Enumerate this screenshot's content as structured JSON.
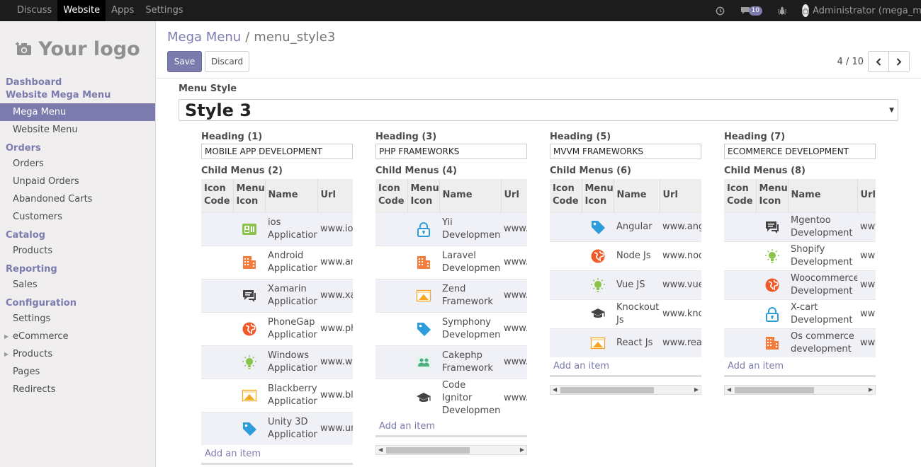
{
  "topbar": {
    "menu": [
      "Discuss",
      "Website",
      "Apps",
      "Settings"
    ],
    "active": "Website",
    "badge_count": "10",
    "user": "Administrator (mega_m..."
  },
  "logo": {
    "text": "Your logo"
  },
  "sidebar": {
    "groups": [
      {
        "title": "Dashboard",
        "items": []
      },
      {
        "title": "Website Mega Menu",
        "items": [
          "Mega Menu",
          "Website Menu"
        ]
      },
      {
        "title": "Orders",
        "items": [
          "Orders",
          "Unpaid Orders",
          "Abandoned Carts",
          "Customers"
        ]
      },
      {
        "title": "Catalog",
        "items": [
          "Products"
        ]
      },
      {
        "title": "Reporting",
        "items": [
          "Sales"
        ]
      },
      {
        "title": "Configuration",
        "items": [
          "Settings",
          "eCommerce",
          "Products",
          "Pages",
          "Redirects"
        ]
      }
    ],
    "active_item": "Mega Menu"
  },
  "breadcrumb": {
    "parent": "Mega Menu",
    "separator": "/",
    "current": "menu_style3"
  },
  "buttons": {
    "save": "Save",
    "discard": "Discard"
  },
  "pager": {
    "value": "4 / 10"
  },
  "menu_style": {
    "label": "Menu Style",
    "value": "Style 3"
  },
  "table_headers": {
    "icon_code": "Icon Code",
    "menu_icon": "Menu Icon",
    "name": "Name",
    "url": "Url"
  },
  "add_item_label": "Add an item",
  "columns": [
    {
      "heading_label": "Heading (1)",
      "heading_value": "MOBILE APP DEVELOPMENT",
      "child_label": "Child Menus (2)",
      "rows": [
        {
          "icon": "contact-card-icon",
          "color": "#8bc34a",
          "name": "ios Application",
          "url": "www.ios"
        },
        {
          "icon": "building-icon",
          "color": "#f47c3c",
          "name": "Android Application",
          "url": "www.an"
        },
        {
          "icon": "chat-icon",
          "color": "#444444",
          "name": "Xamarin Application",
          "url": "www.xar"
        },
        {
          "icon": "globe-icon",
          "color": "#f05a28",
          "name": "PhoneGap Application",
          "url": "www.ph"
        },
        {
          "icon": "bulb-icon",
          "color": "#8bc34a",
          "name": "Windows Application",
          "url": "www.wir"
        },
        {
          "icon": "image-icon",
          "color": "#f5a623",
          "name": "Blackberry Application",
          "url": "www.bla"
        },
        {
          "icon": "tag-icon",
          "color": "#2d9cdb",
          "name": "Unity 3D Application",
          "url": "www.un"
        }
      ]
    },
    {
      "heading_label": "Heading (3)",
      "heading_value": "PHP FRAMEWORKS",
      "child_label": "Child Menus (4)",
      "rows": [
        {
          "icon": "lock-icon",
          "color": "#2d9cdb",
          "name": "Yii Development",
          "url": "www.y"
        },
        {
          "icon": "building-icon",
          "color": "#f47c3c",
          "name": "Laravel Development",
          "url": "www.l"
        },
        {
          "icon": "image-icon",
          "color": "#f5a623",
          "name": "Zend Framework",
          "url": "www.z"
        },
        {
          "icon": "tag-icon",
          "color": "#2d9cdb",
          "name": "Symphony Development",
          "url": "www.s"
        },
        {
          "icon": "group-icon",
          "color": "#4caf82",
          "name": "Cakephp Framework",
          "url": "www.c"
        },
        {
          "icon": "graduation-cap-icon",
          "color": "#444444",
          "name": "Code Ignitor Development",
          "url": "www.c"
        }
      ]
    },
    {
      "heading_label": "Heading (5)",
      "heading_value": "MVVM FRAMEWORKS",
      "child_label": "Child Menus (6)",
      "rows": [
        {
          "icon": "tag-icon",
          "color": "#2d9cdb",
          "name": "Angular",
          "url": "www.angu"
        },
        {
          "icon": "globe-icon",
          "color": "#f05a28",
          "name": "Node Js",
          "url": "www.node"
        },
        {
          "icon": "bulb-icon",
          "color": "#8bc34a",
          "name": "Vue JS",
          "url": "www.vuej"
        },
        {
          "icon": "graduation-cap-icon",
          "color": "#444444",
          "name": "Knockout Js",
          "url": "www.knoc"
        },
        {
          "icon": "image-icon",
          "color": "#f5a623",
          "name": "React Js",
          "url": "www.reac"
        }
      ]
    },
    {
      "heading_label": "Heading (7)",
      "heading_value": "ECOMMERCE DEVELOPMENT",
      "child_label": "Child Menus (8)",
      "rows": [
        {
          "icon": "chat-icon",
          "color": "#444444",
          "name": "Mgentoo Development",
          "url": "www"
        },
        {
          "icon": "bulb-icon",
          "color": "#8bc34a",
          "name": "Shopify Development",
          "url": "www"
        },
        {
          "icon": "globe-icon",
          "color": "#f05a28",
          "name": "Woocommerce Development",
          "url": "www"
        },
        {
          "icon": "lock-icon",
          "color": "#2d9cdb",
          "name": "X-cart Development",
          "url": "www"
        },
        {
          "icon": "building-icon",
          "color": "#f47c3c",
          "name": "Os commerce development",
          "url": "www"
        }
      ]
    }
  ]
}
